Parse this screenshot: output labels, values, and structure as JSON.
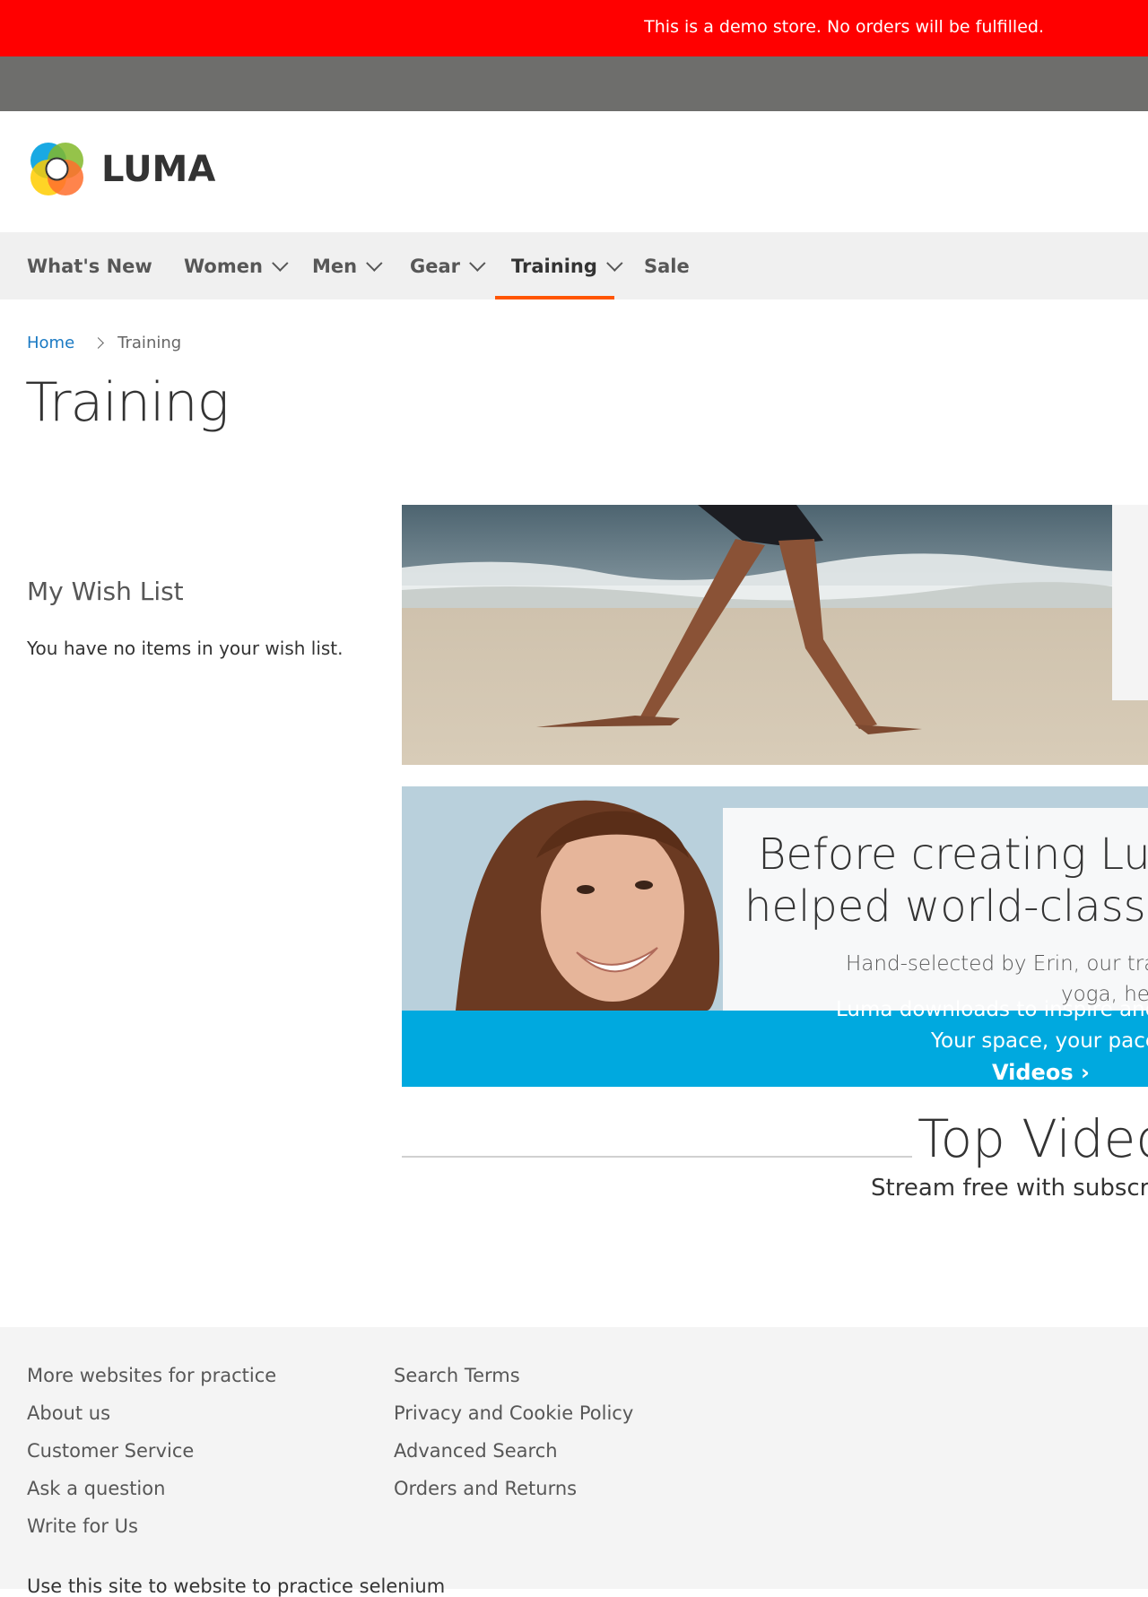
{
  "demo_notice": "This is a demo store. No orders will be fulfilled.",
  "logo": {
    "text": "LUMA",
    "colors": [
      "#00a0e0",
      "#82b92a",
      "#ffcc00",
      "#ff6e2d"
    ]
  },
  "nav": {
    "items": [
      {
        "label": "What's New",
        "has_dropdown": false
      },
      {
        "label": "Women",
        "has_dropdown": true
      },
      {
        "label": "Men",
        "has_dropdown": true
      },
      {
        "label": "Gear",
        "has_dropdown": true
      },
      {
        "label": "Training",
        "has_dropdown": true,
        "active": true
      },
      {
        "label": "Sale",
        "has_dropdown": false
      }
    ],
    "accent": "#ff5501"
  },
  "breadcrumb": {
    "home": "Home",
    "current": "Training"
  },
  "page_title": "Training",
  "wishlist": {
    "title": "My Wish List",
    "empty_text": "You have no items in your wish list."
  },
  "promo": {
    "headline_line1": "Before creating Lum",
    "headline_line2": "helped world-class at",
    "body_line1": "Hand-selected by Erin, our trair",
    "body_line2": "yoga, hea",
    "body_line3": "Luma downloads to inspire and c",
    "body_line4": "Your space, your pace",
    "cta": "Videos"
  },
  "top_videos": {
    "title": "Top Videos",
    "subtitle": "Stream free with subscri"
  },
  "footer": {
    "col1": [
      "More websites for practice",
      "About us",
      "Customer Service",
      "Ask a question",
      "Write for Us"
    ],
    "col2": [
      "Search Terms",
      "Privacy and Cookie Policy",
      "Advanced Search",
      "Orders and Returns"
    ],
    "note": "Use this site to website to practice selenium"
  }
}
